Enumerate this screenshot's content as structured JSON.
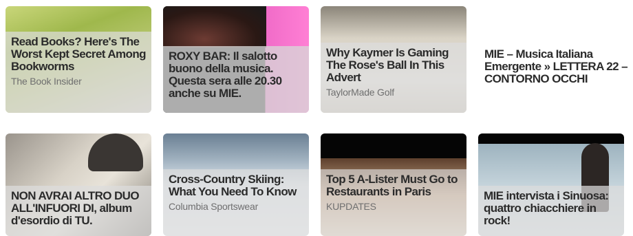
{
  "cards": [
    {
      "title": "Read Books? Here's The Worst Kept Secret Among Bookworms",
      "source": "The Book Insider"
    },
    {
      "title": "ROXY BAR: Il salotto buono della musica. Questa sera alle 20.30 anche su MIE.",
      "source": ""
    },
    {
      "title": "Why Kaymer Is Gaming The Rose's Ball In This Advert",
      "source": "TaylorMade Golf"
    },
    {
      "title": "MIE – Musica Italiana Emergente » LETTERA 22 – CONTORNO OCCHI",
      "source": ""
    },
    {
      "title": "NON AVRAI ALTRO DUO ALL'INFUORI DI, album d'esordio di TU.",
      "source": ""
    },
    {
      "title": "Cross-Country Skiing: What You Need To Know",
      "source": "Columbia Sportswear"
    },
    {
      "title": "Top 5 A-Lister Must Go to Restaurants in Paris",
      "source": "KUPDATES"
    },
    {
      "title": "MIE intervista i Sinuosa: quattro chiacchiere in rock!",
      "source": ""
    }
  ]
}
